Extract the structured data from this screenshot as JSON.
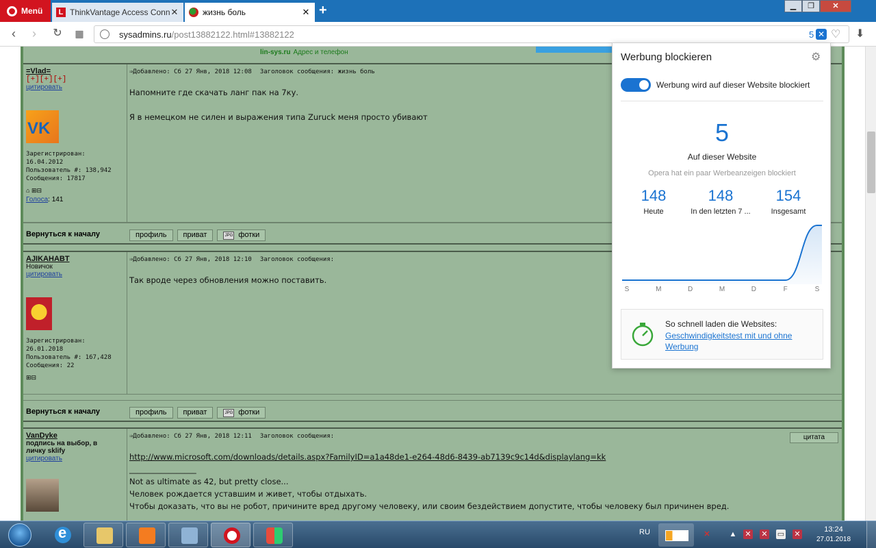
{
  "browser": {
    "menu_label": "Menü",
    "tabs": [
      {
        "label": "ThinkVantage Access Conn",
        "favicon_letter": "L"
      },
      {
        "label": "жизнь боль"
      }
    ],
    "url_host": "sysadmins.ru",
    "url_path": "/post13882122.html#13882122",
    "blocked_count_badge": "5"
  },
  "page": {
    "banner_title": "lin-sys.ru",
    "banner_subtitle": "Адрес и телефон",
    "back_to_top": "Вернуться к началу",
    "profile_btn": "профиль",
    "private_btn": "приват",
    "photos_btn": "фотки",
    "quote_btn": "цитата",
    "quote_link": "цитировать",
    "posts": [
      {
        "username": "=Vlad=",
        "rank": "[+][+][+]",
        "avatar_text": "VK",
        "registered_label": "Зарегистрирован:",
        "registered_date": "16.04.2012",
        "user_no": "Пользователь #: 138,942",
        "messages": "Сообщения: 17817",
        "votes_label": "Голоса",
        "votes_value": ": 141",
        "meta": "Добавлено: Сб 27 Янв, 2018 12:08",
        "subject": "Заголовок сообщения: жизнь боль",
        "body": [
          "Напомните где скачать ланг пак на 7ку.",
          "Я в немецком не силен и выражения типа Zuruck меня просто убивают"
        ]
      },
      {
        "username": "AJIKAHABT",
        "rank": "Новичок",
        "registered_label": "Зарегистрирован:",
        "registered_date": "26.01.2018",
        "user_no": "Пользователь #: 167,428",
        "messages": "Сообщения: 22",
        "meta": "Добавлено: Сб 27 Янв, 2018 12:10",
        "subject": "Заголовок сообщения:",
        "body": [
          "Так вроде через обновления можно поставить."
        ]
      },
      {
        "username": "VanDyke",
        "rank": "подпись на выбор, в личку sklify",
        "meta": "Добавлено: Сб 27 Янв, 2018 12:11",
        "subject": "Заголовок сообщения:",
        "link": "http://www.microsoft.com/downloads/details.aspx?FamilyID=a1a48de1-e264-48d6-8439-ab7139c9c14d&displaylang=kk",
        "separator": "_________________",
        "sig": [
          "Not as ultimate as 42, but pretty close...",
          "Человек рождается уставшим и живет, чтобы отдыхать.",
          "Чтобы доказать, что вы не робот, причините вред другому человеку, или своим бездействием допустите, чтобы человеку был причинен вред."
        ]
      }
    ]
  },
  "adblock_popup": {
    "title": "Werbung blockieren",
    "toggle_label": "Werbung wird auf dieser Website blockiert",
    "toggle_on": true,
    "site_count": "5",
    "site_label": "Auf dieser Website",
    "note": "Opera hat ein paar Werbeanzeigen blockiert",
    "stats": [
      {
        "value": "148",
        "label": "Heute"
      },
      {
        "value": "148",
        "label": "In den letzten 7 ..."
      },
      {
        "value": "154",
        "label": "Insgesamt"
      }
    ],
    "speed_title": "So schnell laden die Websites:",
    "speed_link": "Geschwindigkeitstest mit und ohne Werbung",
    "accent_color": "#1a73d1"
  },
  "chart_data": {
    "type": "area",
    "categories": [
      "S",
      "M",
      "D",
      "M",
      "D",
      "F",
      "S"
    ],
    "values": [
      0,
      0,
      0,
      0,
      0,
      0,
      148
    ],
    "ylim": [
      0,
      148
    ],
    "grid": false
  },
  "taskbar": {
    "lang": "RU",
    "time": "13:24",
    "date": "27.01.2018"
  }
}
